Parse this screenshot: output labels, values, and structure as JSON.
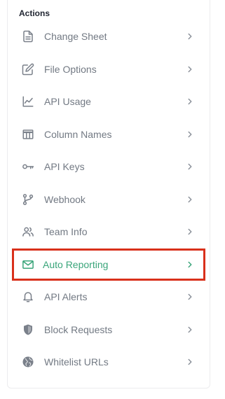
{
  "actions": {
    "title": "Actions",
    "items": [
      {
        "label": "Change Sheet",
        "icon": "document-icon"
      },
      {
        "label": "File Options",
        "icon": "edit-icon"
      },
      {
        "label": "API Usage",
        "icon": "line-chart-icon"
      },
      {
        "label": "Column Names",
        "icon": "columns-icon"
      },
      {
        "label": "API Keys",
        "icon": "key-icon"
      },
      {
        "label": "Webhook",
        "icon": "branch-icon"
      },
      {
        "label": "Team Info",
        "icon": "users-icon"
      },
      {
        "label": "Auto Reporting",
        "icon": "mail-icon",
        "active": true
      },
      {
        "label": "API Alerts",
        "icon": "bell-icon"
      },
      {
        "label": "Block Requests",
        "icon": "shield-icon"
      },
      {
        "label": "Whitelist URLs",
        "icon": "globe-icon"
      }
    ]
  },
  "colors": {
    "active": "#3aa57a",
    "highlight_border": "#d9301b",
    "text": "#727983"
  }
}
